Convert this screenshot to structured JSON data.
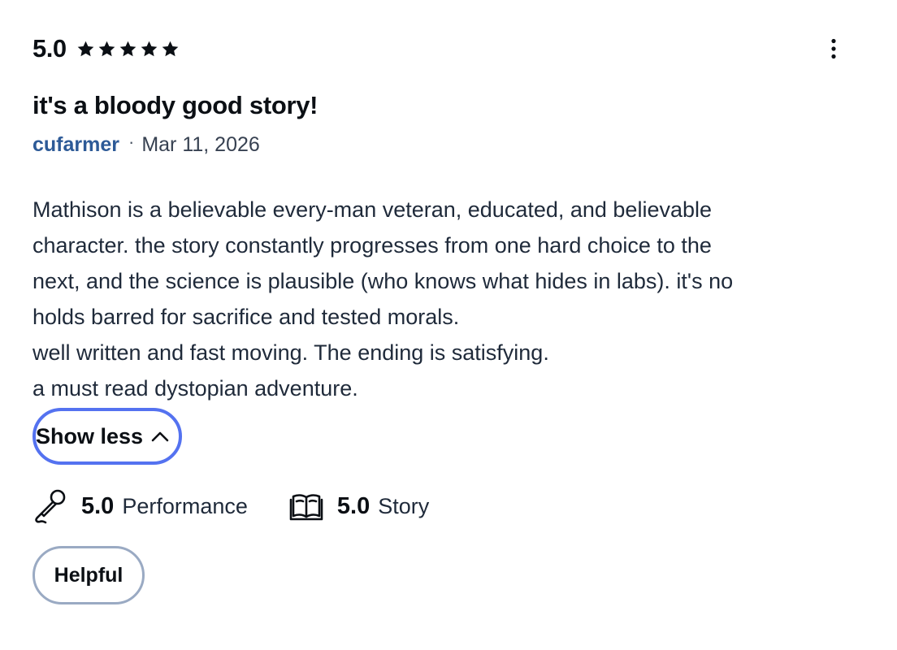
{
  "review": {
    "overall_rating": "5.0",
    "stars": 5,
    "title": "it's a bloody good story!",
    "author": "cufarmer",
    "separator": "·",
    "date": "Mar 11, 2026",
    "body_lines": [
      "Mathison is a believable every-man veteran, educated, and believable",
      "character. the story constantly progresses from one hard choice to the",
      "next, and the science is plausible (who knows what hides in labs). it's no",
      "holds barred for sacrifice and tested morals.",
      "well written and fast moving. The ending is satisfying.",
      "a must read dystopian adventure."
    ],
    "toggle_label": "Show less",
    "subratings": [
      {
        "icon": "microphone-icon",
        "score": "5.0",
        "label": "Performance"
      },
      {
        "icon": "book-icon",
        "score": "5.0",
        "label": "Story"
      }
    ],
    "helpful_label": "Helpful"
  },
  "colors": {
    "text_primary": "#0b0f14",
    "text_body": "#1f2a3a",
    "author_link": "#2d5a97",
    "focus_ring": "#5472f0",
    "helpful_border": "#9aaac3"
  }
}
